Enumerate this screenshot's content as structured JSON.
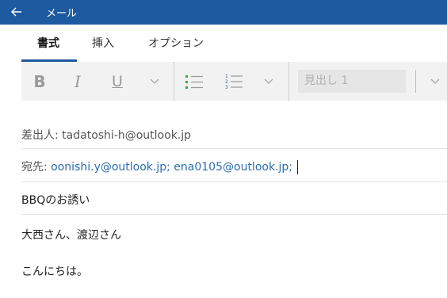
{
  "titlebar": {
    "back_icon": "back-arrow-icon",
    "title": "メール"
  },
  "tabs": [
    {
      "label": "書式",
      "active": true
    },
    {
      "label": "挿入",
      "active": false
    },
    {
      "label": "オプション",
      "active": false
    }
  ],
  "toolbar": {
    "bold_label": "B",
    "italic_label": "I",
    "underline_label": "U",
    "style_placeholder": "見出し 1"
  },
  "mail": {
    "from_label": "差出人:",
    "from_value": "tadatoshi-h@outlook.jp",
    "to_label": "宛先:",
    "to_value": "oonishi.y@outlook.jp; ena0105@outlook.jp;",
    "subject": "BBQのお誘い",
    "body_line1": "大西さん、渡辺さん",
    "body_line2": "こんにちは。"
  },
  "colors": {
    "titlebar": "#1e5aa0",
    "link": "#2b6cb0",
    "toolbar_bg": "#f2f2f2"
  }
}
